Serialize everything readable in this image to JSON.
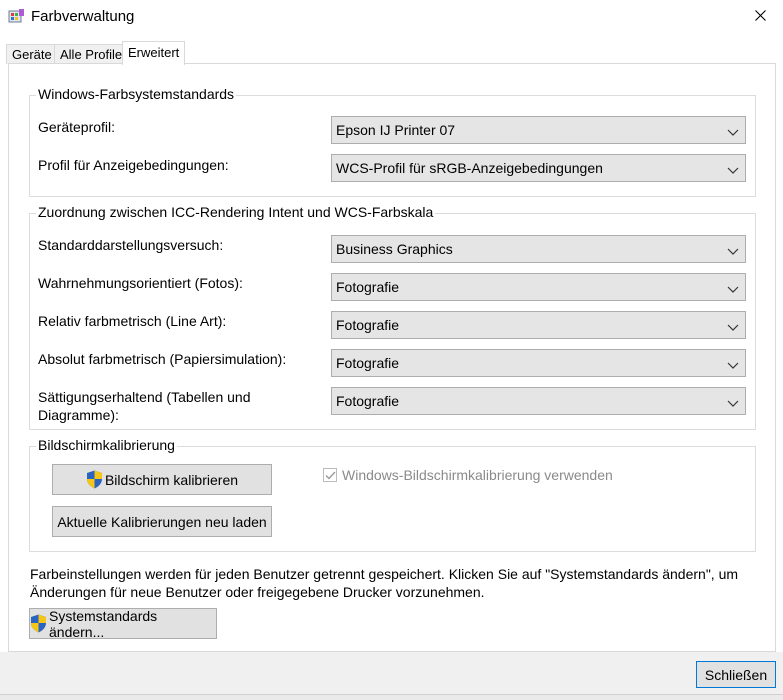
{
  "window": {
    "title": "Farbverwaltung"
  },
  "tabs": [
    {
      "label": "Geräte"
    },
    {
      "label": "Alle Profile"
    },
    {
      "label": "Erweitert"
    }
  ],
  "windows_defaults": {
    "title": "Windows-Farbsystemstandards",
    "rows": [
      {
        "label": "Geräteprofil:",
        "value": "Epson IJ Printer 07"
      },
      {
        "label": "Profil für Anzeigebedingungen:",
        "value": "WCS-Profil für sRGB-Anzeigebedingungen"
      }
    ]
  },
  "mapping": {
    "title": "Zuordnung zwischen ICC-Rendering Intent und WCS-Farbskala",
    "rows": [
      {
        "label": "Standarddarstellungsversuch:",
        "value": "Business Graphics"
      },
      {
        "label": "Wahrnehmungsorientiert (Fotos):",
        "value": "Fotografie"
      },
      {
        "label": "Relativ farbmetrisch (Line Art):",
        "value": "Fotografie"
      },
      {
        "label": "Absolut farbmetrisch (Papiersimulation):",
        "value": "Fotografie"
      },
      {
        "label": "Sättigungserhaltend (Tabellen und Diagramme):",
        "value": "Fotografie"
      }
    ]
  },
  "calibration": {
    "title": "Bildschirmkalibrierung",
    "calibrate_button": "Bildschirm kalibrieren",
    "reload_button": "Aktuelle Kalibrierungen neu laden",
    "checkbox_label": "Windows-Bildschirmkalibrierung verwenden",
    "checkbox_checked": true,
    "checkbox_enabled": false
  },
  "info_text": "Farbeinstellungen werden für jeden Benutzer getrennt gespeichert. Klicken Sie auf \"Systemstandards ändern\", um Änderungen für neue Benutzer oder freigegebene Drucker vorzunehmen.",
  "change_defaults_button": "Systemstandards ändern...",
  "close_button": "Schließen",
  "colors": {
    "accent": "#0078d7",
    "shield_blue": "#2b64c0",
    "shield_yellow": "#f5c518"
  }
}
